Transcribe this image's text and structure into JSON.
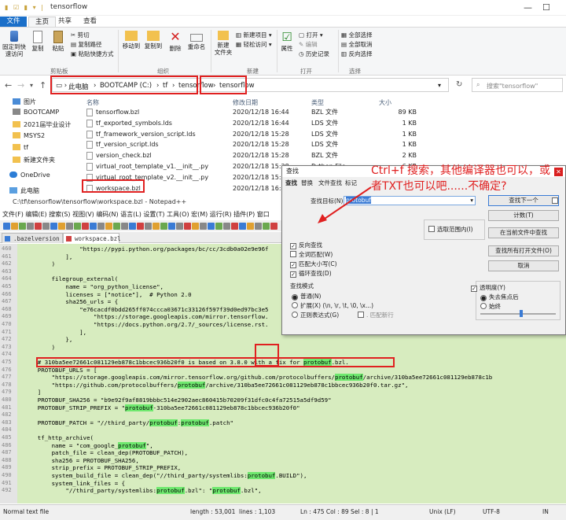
{
  "explorer": {
    "window_title": "tensorflow",
    "ribbon_tabs": [
      "文件",
      "主页",
      "共享",
      "查看"
    ],
    "ribbon": {
      "clipboard": {
        "pin": "固定到快\n速访问",
        "copy": "复制",
        "paste": "粘贴",
        "cut": "剪切",
        "copy_path": "复制路径",
        "paste_shortcut": "粘贴快捷方式",
        "group": "剪贴板"
      },
      "organize": {
        "move_to": "移动到",
        "copy_to": "复制到",
        "delete": "删除",
        "rename": "重命名",
        "group": "组织"
      },
      "new": {
        "new_folder": "新建\n文件夹",
        "new_item": "新建项目",
        "easy_access": "轻松访问",
        "group": "新建"
      },
      "open": {
        "properties": "属性",
        "open": "打开",
        "edit": "编辑",
        "history": "历史记录",
        "group": "打开"
      },
      "select": {
        "select_all": "全部选择",
        "select_none": "全部取消",
        "invert": "反向选择",
        "group": "选择"
      }
    },
    "breadcrumb": [
      "此电脑",
      "BOOTCAMP (C:)",
      "tf",
      "tensorflow",
      "tensorflow"
    ],
    "search_placeholder": "搜索\"tensorflow\"",
    "nav_items": [
      {
        "label": "图片",
        "icon": "pictures-icon"
      },
      {
        "label": "BOOTCAMP",
        "icon": "drive-icon"
      },
      {
        "label": "2021届毕业设计",
        "icon": "folder-icon"
      },
      {
        "label": "MSYS2",
        "icon": "folder-icon"
      },
      {
        "label": "tf",
        "icon": "folder-icon"
      },
      {
        "label": "新建文件夹",
        "icon": "folder-icon"
      },
      {
        "label": "OneDrive",
        "icon": "cloud-icon"
      },
      {
        "label": "此电脑",
        "icon": "computer-icon"
      }
    ],
    "columns": [
      "名称",
      "修改日期",
      "类型",
      "大小"
    ],
    "files": [
      {
        "name": "tensorflow.bzl",
        "date": "2020/12/18 16:44",
        "type": "BZL 文件",
        "size": "89 KB"
      },
      {
        "name": "tf_exported_symbols.lds",
        "date": "2020/12/18 16:44",
        "type": "LDS 文件",
        "size": "1 KB"
      },
      {
        "name": "tf_framework_version_script.lds",
        "date": "2020/12/18 15:28",
        "type": "LDS 文件",
        "size": "1 KB"
      },
      {
        "name": "tf_version_script.lds",
        "date": "2020/12/18 15:28",
        "type": "LDS 文件",
        "size": "1 KB"
      },
      {
        "name": "version_check.bzl",
        "date": "2020/12/18 15:28",
        "type": "BZL 文件",
        "size": "2 KB"
      },
      {
        "name": "virtual_root_template_v1.__init__.py",
        "date": "2020/12/18 15:28",
        "type": "Python File",
        "size": "6 KB"
      },
      {
        "name": "virtual_root_template_v2.__init__.py",
        "date": "2020/12/18 15:28",
        "type": "PY 文件",
        "size": ""
      },
      {
        "name": "workspace.bzl",
        "date": "2020/12/18 16:44",
        "type": "",
        "size": ""
      }
    ]
  },
  "notepad": {
    "title": "C:\\tf\\tensorflow\\tensorflow\\workspace.bzl - Notepad++",
    "menu": "文件(F)  编辑(E)  搜索(S)  视图(V)  编码(N)  语言(L)  设置(T)  工具(O)  宏(M)  运行(R)  插件(P)  窗口",
    "tabs": [
      ".bazelversion",
      "workspace.bzl"
    ],
    "lines": [
      {
        "n": "460",
        "t": "                \"https://pypi.python.org/packages/bc/cc/3cdb0a02e9e96f"
      },
      {
        "n": "461",
        "t": "            ],"
      },
      {
        "n": "462",
        "t": "        )"
      },
      {
        "n": "463",
        "t": ""
      },
      {
        "n": "464",
        "t": "        filegroup_external("
      },
      {
        "n": "465",
        "t": "            name = \"org_python_license\","
      },
      {
        "n": "466",
        "t": "            licenses = [\"notice\"],  # Python 2.0"
      },
      {
        "n": "467",
        "t": "            sha256_urls = {"
      },
      {
        "n": "468",
        "t": "                \"e76cacdf0bdd265ff074ccca03671c33126f597f39d0ed97bc3e5"
      },
      {
        "n": "469",
        "t": "                    \"https://storage.googleapis.com/mirror.tensorflow."
      },
      {
        "n": "470",
        "t": "                    \"https://docs.python.org/2.7/_sources/license.rst."
      },
      {
        "n": "471",
        "t": "                ],"
      },
      {
        "n": "472",
        "t": "            },"
      },
      {
        "n": "473",
        "t": "        )"
      },
      {
        "n": "474",
        "t": ""
      },
      {
        "n": "475",
        "t": "    # 310ba5ee72661c081129eb878c1bbcec936b20f0 is based on 3.8.0 with a fix for protobuf.bzl."
      },
      {
        "n": "476",
        "t": "    PROTOBUF_URLS = ["
      },
      {
        "n": "477",
        "t": "        \"https://storage.googleapis.com/mirror.tensorflow.org/github.com/protocolbuffers/protobuf/archive/310ba5ee72661c081129eb878c1b"
      },
      {
        "n": "478",
        "t": "        \"https://github.com/protocolbuffers/protobuf/archive/310ba5ee72661c081129eb878c1bbcec936b20f0.tar.gz\","
      },
      {
        "n": "479",
        "t": "    ]"
      },
      {
        "n": "480",
        "t": "    PROTOBUF_SHA256 = \"b9e92f9af8819bbbc514e2902aec860415b70209f31dfc0c4fa72515a5df9d59\""
      },
      {
        "n": "481",
        "t": "    PROTOBUF_STRIP_PREFIX = \"protobuf-310ba5ee72661c081129eb878c1bbcec936b20f0\""
      },
      {
        "n": "482",
        "t": ""
      },
      {
        "n": "483",
        "t": "    PROTOBUF_PATCH = \"//third_party/protobuf:protobuf.patch\""
      },
      {
        "n": "484",
        "t": ""
      },
      {
        "n": "485",
        "t": "    tf_http_archive("
      },
      {
        "n": "486",
        "t": "        name = \"com_google_protobuf\","
      },
      {
        "n": "487",
        "t": "        patch_file = clean_dep(PROTOBUF_PATCH),"
      },
      {
        "n": "488",
        "t": "        sha256 = PROTOBUF_SHA256,"
      },
      {
        "n": "489",
        "t": "        strip_prefix = PROTOBUF_STRIP_PREFIX,"
      },
      {
        "n": "490",
        "t": "        system_build_file = clean_dep(\"//third_party/systemlibs:protobuf.BUILD\"),"
      },
      {
        "n": "491",
        "t": "        system_link_files = {"
      },
      {
        "n": "492",
        "t": "            \"//third_party/systemlibs:protobuf.bzl\": \"protobuf.bzl\","
      }
    ],
    "status": {
      "type": "Normal text file",
      "length": "length : 53,001",
      "lines": "lines : 1,103",
      "pos": "Ln : 475   Col : 89   Sel : 8 | 1",
      "eol": "Unix (LF)",
      "enc": "UTF-8",
      "ins": "IN"
    }
  },
  "find": {
    "title": "查找",
    "tabs": [
      "查找",
      "替换",
      "文件查找",
      "标记"
    ],
    "label": "查找目标(N) :",
    "value": "protobuf",
    "buttons": [
      "查找下一个",
      "计数(T)",
      "在当前文件中查找",
      "查找所有打开文件(O)",
      "取消"
    ],
    "in_selection": "选取范围内(I)",
    "options": [
      "反向查找",
      "全词匹配(W)",
      "匹配大小写(C)",
      "循环查找(D)"
    ],
    "mode_title": "查找模式",
    "modes": [
      "普通(N)",
      "扩展(X) (\\n, \\r, \\t, \\0, \\x...)",
      "正则表达式(G)"
    ],
    "dotnewline": ". 匹配新行",
    "transparency": "透明度(Y)",
    "trans_opts": [
      "失去焦点后",
      "始终"
    ]
  },
  "annotation": "Ctrl+f 搜索，其他编译器也可以，或者TXT也可以吧......不确定?",
  "colors": {
    "accent": "#1a6fc9",
    "red": "#e02020",
    "editor_bg": "#d7ecbf",
    "match": "#6ee86e"
  }
}
